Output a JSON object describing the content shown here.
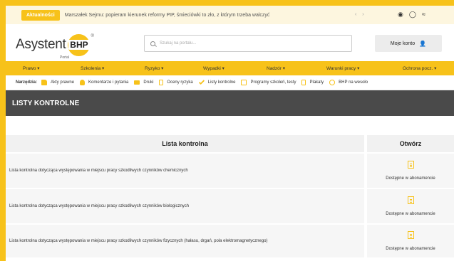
{
  "newsbar": {
    "badge": "Aktualności",
    "text": "Marszałek Sejmu: popieram kierunek reformy PIP, śmieciówki to zło, z którym trzeba walczyć",
    "arrows": "‹ ›",
    "social": [
      "facebook-icon",
      "instagram-icon",
      "rss-icon"
    ]
  },
  "header": {
    "logo_text": "Asystent",
    "logo_mark": "BHP",
    "logo_sub": "Portal",
    "search_placeholder": "Szukaj na portalu...",
    "account_label": "Moje konto"
  },
  "nav": {
    "items": [
      {
        "label": "Prawo ▾"
      },
      {
        "label": "Szkolenia ▾"
      },
      {
        "label": "Ryzyko ▾"
      },
      {
        "label": "Wypadki ▾"
      },
      {
        "label": "Nadzór ▾"
      },
      {
        "label": "Warunki pracy ▾"
      },
      {
        "label": "Ochrona pocz. ▾"
      }
    ]
  },
  "tools": {
    "label": "Narzędzia:",
    "items": [
      {
        "label": "Akty prawne",
        "icon": "folder-icon"
      },
      {
        "label": "Komentarze i pytania",
        "icon": "person-icon"
      },
      {
        "label": "Druki",
        "icon": "printer-icon"
      },
      {
        "label": "Oceny ryzyka",
        "icon": "document-icon"
      },
      {
        "label": "Listy kontrolne",
        "icon": "check-icon"
      },
      {
        "label": "Programy szkoleń, testy",
        "icon": "checkbox-icon"
      },
      {
        "label": "Plakaty",
        "icon": "poster-icon"
      },
      {
        "label": "BHP na wesoło",
        "icon": "smile-icon"
      }
    ]
  },
  "page": {
    "title": "LISTY KONTROLNE"
  },
  "table": {
    "headers": [
      "Lista kontrolna",
      "Otwórz"
    ],
    "rows": [
      {
        "name": "Lista kontrolna dotycząca występowania w miejscu pracy szkodliwych czynników chemicznych",
        "status": "Dostępne w abonamencie"
      },
      {
        "name": "Lista kontrolna dotycząca występowania w miejscu pracy szkodliwych czynników biologicznych",
        "status": "Dostępne w abonamencie"
      },
      {
        "name": "Lista kontrolna dotycząca występowania w miejscu pracy szkodliwych czynników fizycznych (hałasu, drgań, pola elektromagnetycznego)",
        "status": "Dostępne w abonamencie"
      }
    ]
  },
  "colors": {
    "accent": "#f7c21a",
    "title_bar": "#4a4a4a"
  }
}
